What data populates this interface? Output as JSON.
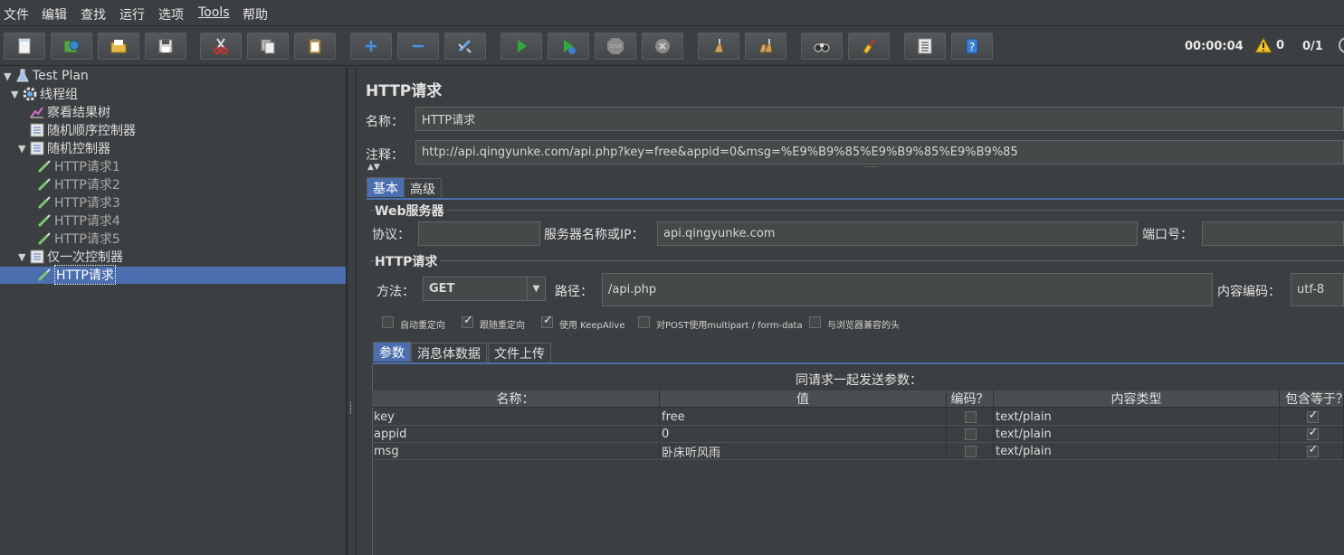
{
  "menu": {
    "file": "文件",
    "edit": "编辑",
    "search": "查找",
    "run": "运行",
    "options": "选项",
    "tools": "Tools",
    "help": "帮助"
  },
  "toolbar": {
    "buttons": [
      {
        "name": "new-button",
        "icon": "new-document-icon"
      },
      {
        "name": "templates-button",
        "icon": "templates-icon"
      },
      {
        "name": "open-button",
        "icon": "open-folder-icon"
      },
      {
        "name": "save-button",
        "icon": "save-icon"
      },
      {
        "name": "cut-button",
        "icon": "scissors-icon"
      },
      {
        "name": "copy-button",
        "icon": "copy-icon"
      },
      {
        "name": "paste-button",
        "icon": "paste-icon"
      },
      {
        "name": "expand-button",
        "icon": "plus-icon"
      },
      {
        "name": "collapse-button",
        "icon": "minus-icon"
      },
      {
        "name": "toggle-button",
        "icon": "toggle-icon"
      },
      {
        "name": "start-button",
        "icon": "play-icon"
      },
      {
        "name": "start-no-pause-button",
        "icon": "play-no-timer-icon"
      },
      {
        "name": "stop-button",
        "icon": "stop-icon"
      },
      {
        "name": "shutdown-button",
        "icon": "shutdown-icon"
      },
      {
        "name": "clear-button",
        "icon": "broom-icon"
      },
      {
        "name": "clear-all-button",
        "icon": "broom-all-icon"
      },
      {
        "name": "search-button",
        "icon": "binoculars-icon"
      },
      {
        "name": "reset-search-button",
        "icon": "reset-search-icon"
      },
      {
        "name": "function-helper-button",
        "icon": "list-icon"
      },
      {
        "name": "help-button",
        "icon": "help-icon"
      }
    ],
    "timer": "00:00:04",
    "warnings": "0",
    "threads": "0/1"
  },
  "tree": {
    "test_plan": "Test Plan",
    "thread_group": "线程组",
    "view_results_tree": "察看结果树",
    "random_order_controller": "随机顺序控制器",
    "random_controller": "随机控制器",
    "http1": "HTTP请求1",
    "http2": "HTTP请求2",
    "http3": "HTTP请求3",
    "http4": "HTTP请求4",
    "http5": "HTTP请求5",
    "once_only_controller": "仅一次控制器",
    "http_selected": "HTTP请求"
  },
  "panel": {
    "title": "HTTP请求",
    "name_label": "名称：",
    "name_value": "HTTP请求",
    "comment_label": "注释：",
    "comment_value": "http://api.qingyunke.com/api.php?key=free&appid=0&msg=%E9%B9%85%E9%B9%85%E9%B9%85",
    "tabs": {
      "basic": "基本",
      "advanced": "高级"
    },
    "web_server": {
      "title": "Web服务器",
      "protocol_label": "协议：",
      "protocol_value": "",
      "server_label": "服务器名称或IP：",
      "server_value": "api.qingyunke.com",
      "port_label": "端口号：",
      "port_value": ""
    },
    "http_request": {
      "title": "HTTP请求",
      "method_label": "方法：",
      "method_value": "GET",
      "path_label": "路径：",
      "path_value": "/api.php",
      "encoding_label": "内容编码：",
      "encoding_value": "utf-8"
    },
    "checkboxes": [
      {
        "label": "自动重定向",
        "checked": false
      },
      {
        "label": "跟随重定向",
        "checked": true
      },
      {
        "label": "使用 KeepAlive",
        "checked": true
      },
      {
        "label": "对POST使用multipart / form-data",
        "checked": false
      },
      {
        "label": "与浏览器兼容的头",
        "checked": false
      }
    ],
    "subtabs": {
      "params": "参数",
      "body": "消息体数据",
      "files": "文件上传"
    },
    "params_caption": "同请求一起发送参数：",
    "table": {
      "headers": [
        "名称：",
        "值",
        "编码？",
        "内容类型",
        "包含等于？"
      ],
      "rows": [
        {
          "name": "key",
          "value": "free",
          "encode": false,
          "content_type": "text/plain",
          "include_equals": true
        },
        {
          "name": "appid",
          "value": "0",
          "encode": false,
          "content_type": "text/plain",
          "include_equals": true
        },
        {
          "name": "msg",
          "value": "卧床听风雨",
          "encode": false,
          "content_type": "text/plain",
          "include_equals": true
        }
      ]
    }
  }
}
